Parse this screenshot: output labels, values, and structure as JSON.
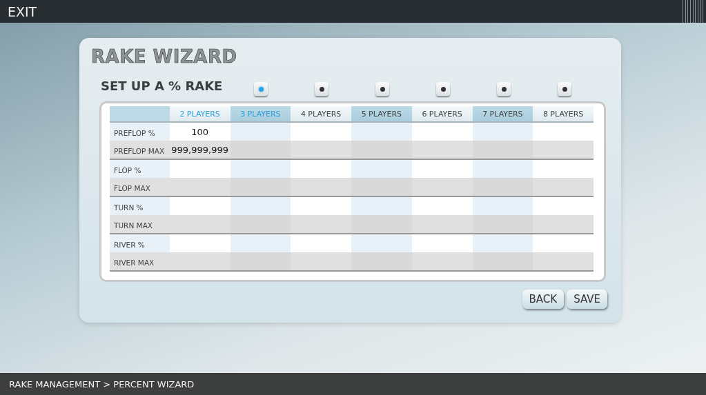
{
  "top_bar": {
    "exit": "EXIT"
  },
  "wizard": {
    "title": "RAKE WIZARD",
    "subtitle": "SET UP A % RAKE",
    "columns": [
      {
        "label": "2 PLAYERS",
        "enabled": true
      },
      {
        "label": "3 PLAYERS",
        "enabled": true,
        "toggle_on": true
      },
      {
        "label": "4 PLAYERS",
        "enabled": false,
        "toggle_on": false
      },
      {
        "label": "5 PLAYERS",
        "enabled": false,
        "toggle_on": false
      },
      {
        "label": "6 PLAYERS",
        "enabled": false,
        "toggle_on": false
      },
      {
        "label": "7 PLAYERS",
        "enabled": false,
        "toggle_on": false
      },
      {
        "label": "8 PLAYERS",
        "enabled": false,
        "toggle_on": false
      }
    ],
    "rows": [
      {
        "kind": "percent",
        "label": "PREFLOP %",
        "values": [
          "100"
        ]
      },
      {
        "kind": "max",
        "label": "PREFLOP MAX",
        "values": [
          "999,999,999"
        ]
      },
      {
        "kind": "percent",
        "label": "FLOP %"
      },
      {
        "kind": "max",
        "label": "FLOP MAX"
      },
      {
        "kind": "percent",
        "label": "TURN %"
      },
      {
        "kind": "max",
        "label": "TURN MAX"
      },
      {
        "kind": "percent",
        "label": "RIVER %"
      },
      {
        "kind": "max",
        "label": "RIVER MAX"
      }
    ],
    "buttons": [
      "BACK",
      "SAVE"
    ]
  },
  "breadcrumb": "RAKE MANAGEMENT > PERCENT WIZARD"
}
